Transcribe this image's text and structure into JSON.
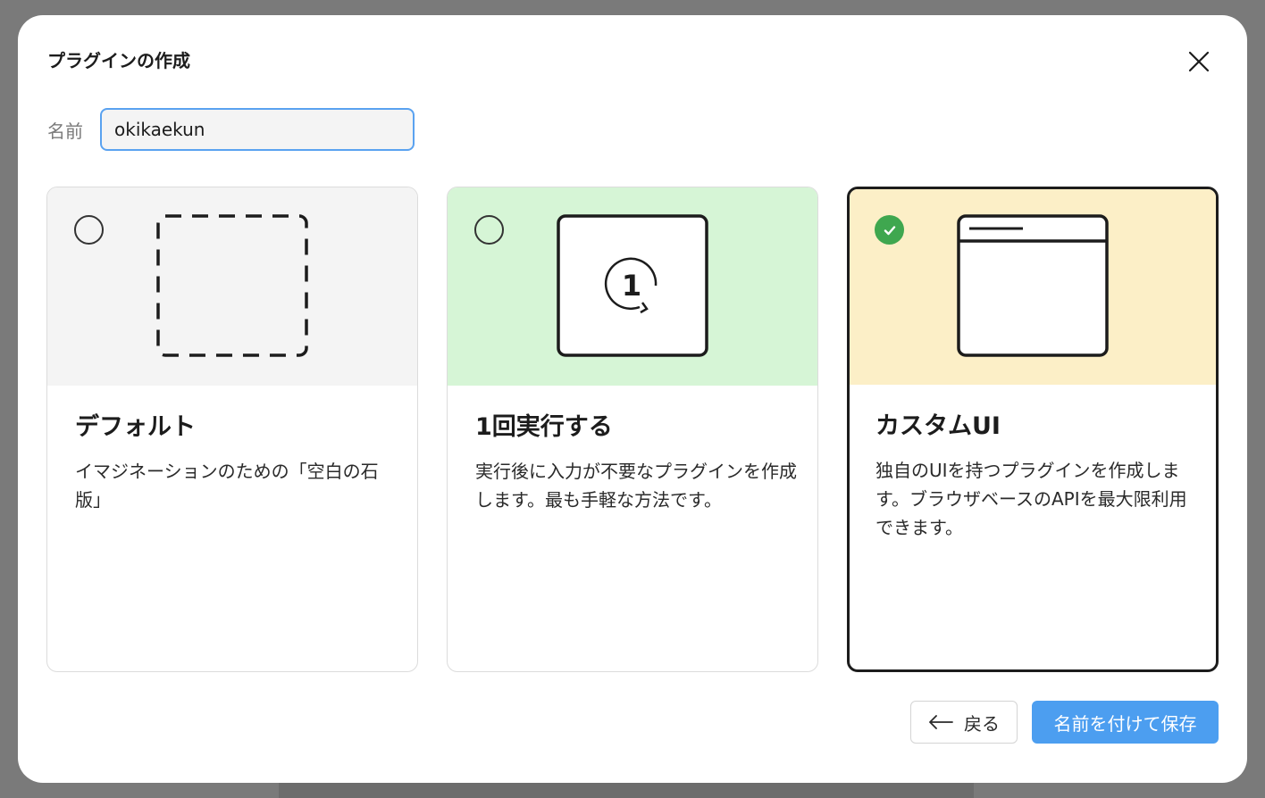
{
  "dialog": {
    "title": "プラグインの作成",
    "close_icon": "close-icon"
  },
  "name_field": {
    "label": "名前",
    "value": "okikaekun"
  },
  "cards": [
    {
      "title": "デフォルト",
      "description": "イマジネーションのための「空白の石版」",
      "bg_color": "#f4f4f4",
      "icon": "dashed-square-icon",
      "selected": false
    },
    {
      "title": "1回実行する",
      "description": "実行後に入力が不要なプラグインを作成します。最も手軽な方法です。",
      "bg_color": "#d6f5d6",
      "icon": "run-once-icon",
      "icon_text": "1",
      "selected": false
    },
    {
      "title": "カスタムUI",
      "description": "独自のUIを持つプラグインを作成します。ブラウザベースのAPIを最大限利用できます。",
      "bg_color": "#fcefc7",
      "icon": "window-icon",
      "selected": true
    }
  ],
  "footer": {
    "back_label": "戻る",
    "back_icon": "arrow-left-icon",
    "save_label": "名前を付けて保存"
  },
  "colors": {
    "accent": "#4c9ef0",
    "check": "#3fa74f",
    "input_border": "#5aa2f0"
  }
}
